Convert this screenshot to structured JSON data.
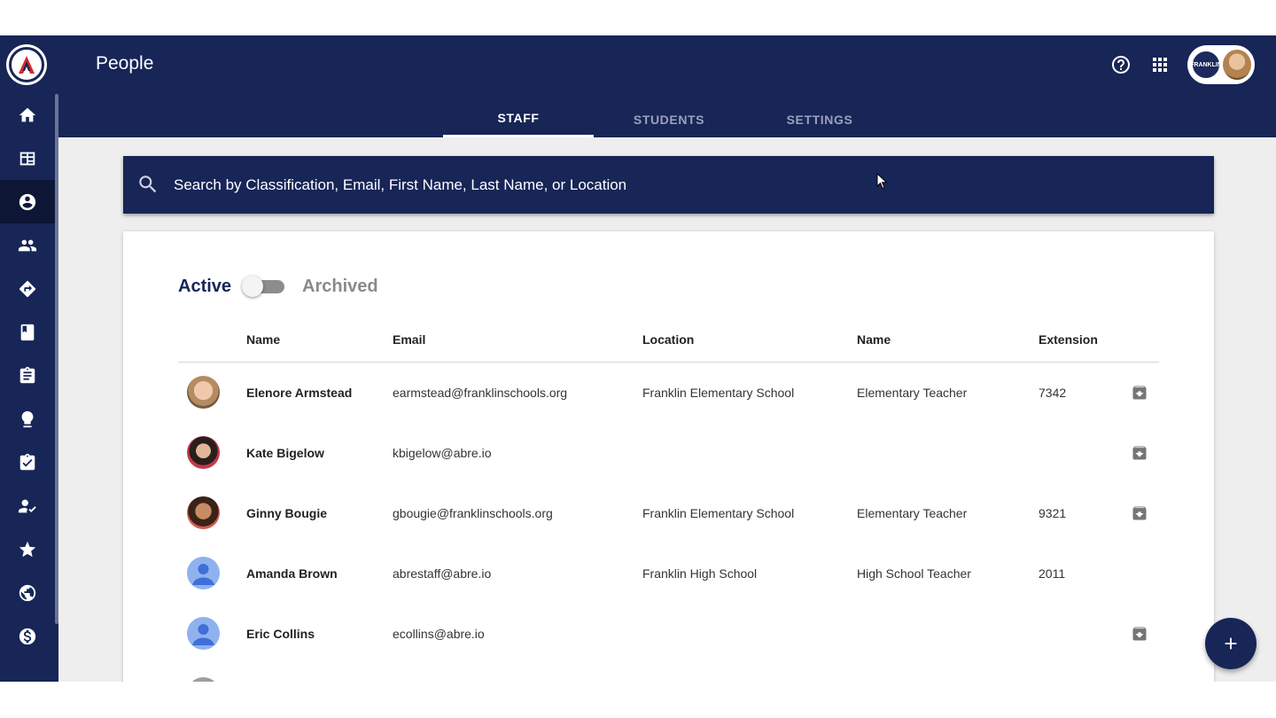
{
  "app": {
    "page_title": "People",
    "logo_name": "abre-logo"
  },
  "sidebar": {
    "items": [
      {
        "icon": "home-icon"
      },
      {
        "icon": "dashboard-icon"
      },
      {
        "icon": "account-circle-icon",
        "active": true
      },
      {
        "icon": "people-icon"
      },
      {
        "icon": "directions-icon"
      },
      {
        "icon": "book-icon"
      },
      {
        "icon": "assignment-icon"
      },
      {
        "icon": "lightbulb-icon"
      },
      {
        "icon": "assignment-check-icon"
      },
      {
        "icon": "person-check-icon"
      },
      {
        "icon": "star-icon"
      },
      {
        "icon": "globe-icon"
      },
      {
        "icon": "dollar-icon"
      }
    ]
  },
  "topbar": {
    "help_icon": "help-icon",
    "apps_icon": "apps-grid-icon",
    "district_label": "FRANKLIN"
  },
  "tabs": [
    {
      "label": "STAFF",
      "active": true
    },
    {
      "label": "STUDENTS",
      "active": false
    },
    {
      "label": "SETTINGS",
      "active": false
    }
  ],
  "search": {
    "placeholder": "Search by Classification, Email, First Name, Last Name, or Location",
    "value": ""
  },
  "filter": {
    "active_label": "Active",
    "archived_label": "Archived",
    "show_archived": false
  },
  "table": {
    "headers": {
      "name": "Name",
      "email": "Email",
      "location": "Location",
      "title": "Name",
      "extension": "Extension"
    },
    "rows": [
      {
        "name": "Elenore Armstead",
        "email": "earmstead@franklinschools.org",
        "location": "Franklin Elementary School",
        "title": "Elementary Teacher",
        "extension": "7342",
        "avatar": "photo",
        "archivable": true
      },
      {
        "name": "Kate Bigelow",
        "email": "kbigelow@abre.io",
        "location": "",
        "title": "",
        "extension": "",
        "avatar": "photo",
        "archivable": true
      },
      {
        "name": "Ginny Bougie",
        "email": "gbougie@franklinschools.org",
        "location": "Franklin Elementary School",
        "title": "Elementary Teacher",
        "extension": "9321",
        "avatar": "photo",
        "archivable": true
      },
      {
        "name": "Amanda Brown",
        "email": "abrestaff@abre.io",
        "location": "Franklin High School",
        "title": "High School Teacher",
        "extension": "2011",
        "avatar": "generic",
        "archivable": false
      },
      {
        "name": "Eric Collins",
        "email": "ecollins@abre.io",
        "location": "",
        "title": "",
        "extension": "",
        "avatar": "generic",
        "archivable": true
      }
    ]
  },
  "fab": {
    "icon": "add-icon"
  },
  "colors": {
    "primary": "#172557",
    "background": "#eeeeee",
    "surface": "#ffffff"
  }
}
